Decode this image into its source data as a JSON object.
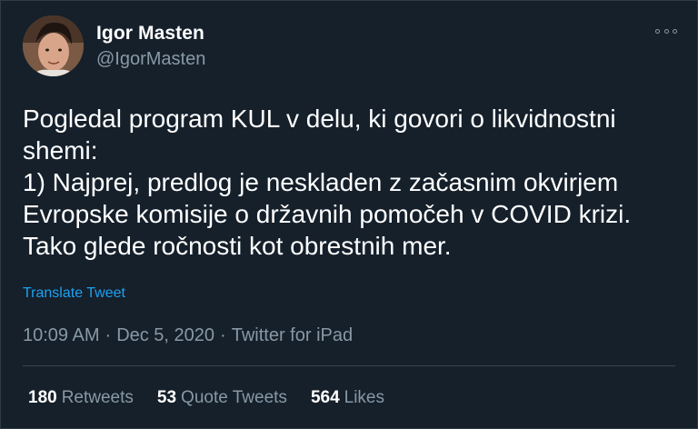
{
  "author": {
    "name": "Igor Masten",
    "handle": "@IgorMasten"
  },
  "tweet": {
    "text": "Pogledal program KUL v delu, ki govori o likvidnostni\nshemi:\n1) Najprej, predlog je neskladen z začasnim okvirjem\nEvropske komisije o državnih pomočeh v COVID krizi.\nTako glede ročnosti kot obrestnih mer.",
    "translate_label": "Translate Tweet",
    "time": "10:09 AM",
    "date": "Dec 5, 2020",
    "source": "Twitter for iPad",
    "separator": "·"
  },
  "stats": {
    "retweets": {
      "count": "180",
      "label": "Retweets"
    },
    "quote_tweets": {
      "count": "53",
      "label": "Quote Tweets"
    },
    "likes": {
      "count": "564",
      "label": "Likes"
    }
  },
  "colors": {
    "background": "#15202b",
    "text": "#ffffff",
    "secondary": "#8899a6",
    "link": "#1da1f2"
  },
  "icons": {
    "more": "more-horizontal-icon"
  }
}
